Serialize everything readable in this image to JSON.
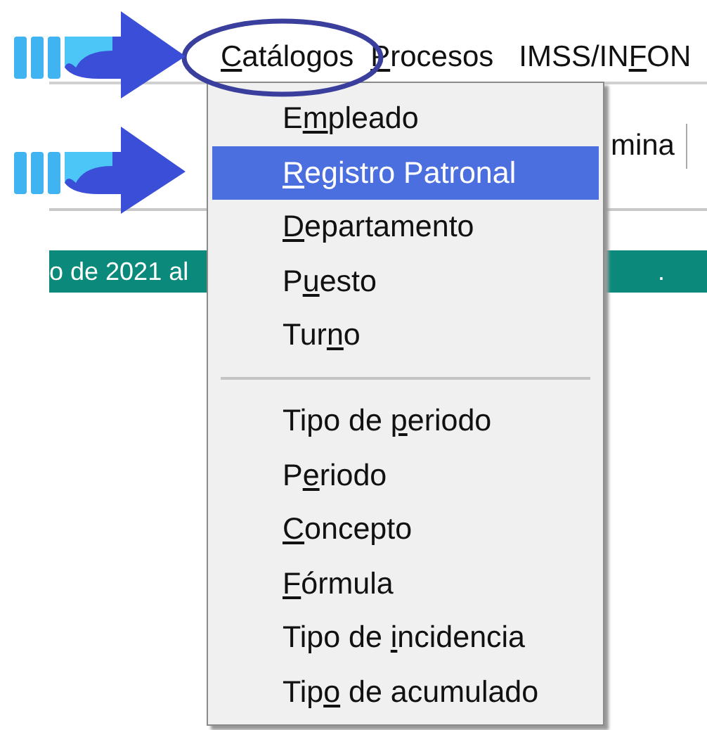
{
  "menu_bar": [
    {
      "label": {
        "key": "C",
        "after": "atálogos"
      }
    },
    {
      "label": {
        "key": "P",
        "after": "rocesos"
      }
    },
    {
      "label": {
        "before": "IMSS/IN",
        "key": "F",
        "after": "ON"
      }
    }
  ],
  "toolbar": {
    "text": "mina"
  },
  "status_bar": {
    "texts": [
      "o de 2021 al",
      "."
    ]
  },
  "dropdown": [
    {
      "kind": "item",
      "selected": false,
      "label": {
        "before": "E",
        "key": "m",
        "after": "pleado"
      }
    },
    {
      "kind": "item",
      "selected": true,
      "label": {
        "key": "R",
        "after": "egistro Patronal"
      }
    },
    {
      "kind": "item",
      "selected": false,
      "label": {
        "key": "D",
        "after": "epartamento"
      }
    },
    {
      "kind": "item",
      "selected": false,
      "label": {
        "before": "P",
        "key": "u",
        "after": "esto"
      }
    },
    {
      "kind": "item",
      "selected": false,
      "label": {
        "before": "Tur",
        "key": "n",
        "after": "o"
      }
    },
    {
      "kind": "separator"
    },
    {
      "kind": "item",
      "selected": false,
      "label": {
        "before": "Tipo de ",
        "key": "p",
        "after": "eriodo"
      }
    },
    {
      "kind": "item",
      "selected": false,
      "label": {
        "before": "P",
        "key": "e",
        "after": "riodo"
      }
    },
    {
      "kind": "item",
      "selected": false,
      "label": {
        "key": "C",
        "after": "oncepto"
      }
    },
    {
      "kind": "item",
      "selected": false,
      "label": {
        "key": "F",
        "after": "órmula"
      }
    },
    {
      "kind": "item",
      "selected": false,
      "label": {
        "before": "Tipo de ",
        "key": "i",
        "after": "ncidencia"
      }
    },
    {
      "kind": "item",
      "selected": false,
      "label": {
        "before": "Tip",
        "key": "o",
        "after": " de acumulado"
      }
    }
  ]
}
